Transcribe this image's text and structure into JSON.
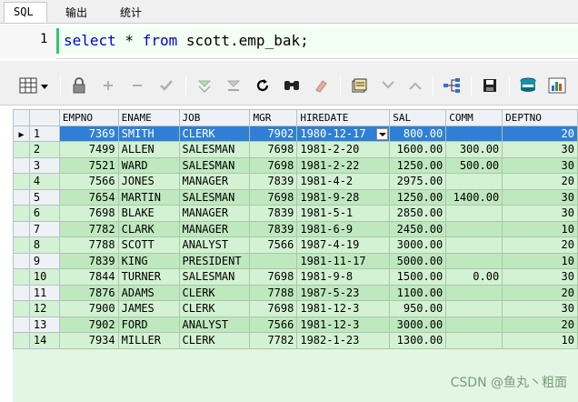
{
  "tabs": [
    {
      "label": "SQL",
      "active": true
    },
    {
      "label": "输出",
      "active": false
    },
    {
      "label": "统计",
      "active": false
    }
  ],
  "editor": {
    "line_number": "1",
    "kw_select": "select",
    "star": " * ",
    "kw_from": "from",
    "rest": " scott.emp_bak;"
  },
  "toolbar": {
    "icons": [
      "grid-options-icon",
      "lock-icon",
      "add-record-icon",
      "delete-record-icon",
      "post-changes-icon",
      "query-by-example-icon",
      "clear-qbe-icon",
      "refresh-icon",
      "find-icon",
      "clear-icon",
      "single-record-view-icon",
      "nav-down-icon",
      "nav-up-icon",
      "link-icon",
      "save-icon",
      "export-icon",
      "chart-icon"
    ]
  },
  "grid": {
    "columns": [
      "EMPNO",
      "ENAME",
      "JOB",
      "MGR",
      "HIREDATE",
      "SAL",
      "COMM",
      "DEPTNO"
    ],
    "selected_row": 0,
    "rows": [
      [
        "1",
        "7369",
        "SMITH",
        "CLERK",
        "7902",
        "1980-12-17",
        "800.00",
        "",
        "20"
      ],
      [
        "2",
        "7499",
        "ALLEN",
        "SALESMAN",
        "7698",
        "1981-2-20",
        "1600.00",
        "300.00",
        "30"
      ],
      [
        "3",
        "7521",
        "WARD",
        "SALESMAN",
        "7698",
        "1981-2-22",
        "1250.00",
        "500.00",
        "30"
      ],
      [
        "4",
        "7566",
        "JONES",
        "MANAGER",
        "7839",
        "1981-4-2",
        "2975.00",
        "",
        "20"
      ],
      [
        "5",
        "7654",
        "MARTIN",
        "SALESMAN",
        "7698",
        "1981-9-28",
        "1250.00",
        "1400.00",
        "30"
      ],
      [
        "6",
        "7698",
        "BLAKE",
        "MANAGER",
        "7839",
        "1981-5-1",
        "2850.00",
        "",
        "30"
      ],
      [
        "7",
        "7782",
        "CLARK",
        "MANAGER",
        "7839",
        "1981-6-9",
        "2450.00",
        "",
        "10"
      ],
      [
        "8",
        "7788",
        "SCOTT",
        "ANALYST",
        "7566",
        "1987-4-19",
        "3000.00",
        "",
        "20"
      ],
      [
        "9",
        "7839",
        "KING",
        "PRESIDENT",
        "",
        "1981-11-17",
        "5000.00",
        "",
        "10"
      ],
      [
        "10",
        "7844",
        "TURNER",
        "SALESMAN",
        "7698",
        "1981-9-8",
        "1500.00",
        "0.00",
        "30"
      ],
      [
        "11",
        "7876",
        "ADAMS",
        "CLERK",
        "7788",
        "1987-5-23",
        "1100.00",
        "",
        "20"
      ],
      [
        "12",
        "7900",
        "JAMES",
        "CLERK",
        "7698",
        "1981-12-3",
        "950.00",
        "",
        "30"
      ],
      [
        "13",
        "7902",
        "FORD",
        "ANALYST",
        "7566",
        "1981-12-3",
        "3000.00",
        "",
        "20"
      ],
      [
        "14",
        "7934",
        "MILLER",
        "CLERK",
        "7782",
        "1982-1-23",
        "1300.00",
        "",
        "10"
      ]
    ]
  },
  "watermark": "CSDN @鱼丸丶粗面",
  "colors": {
    "keyword": "#0000e0",
    "selection": "#2f7fd6",
    "row_green": "#bfe8bf",
    "row_green_alt": "#d3f1d3",
    "active_line_border": "#34c66a"
  }
}
